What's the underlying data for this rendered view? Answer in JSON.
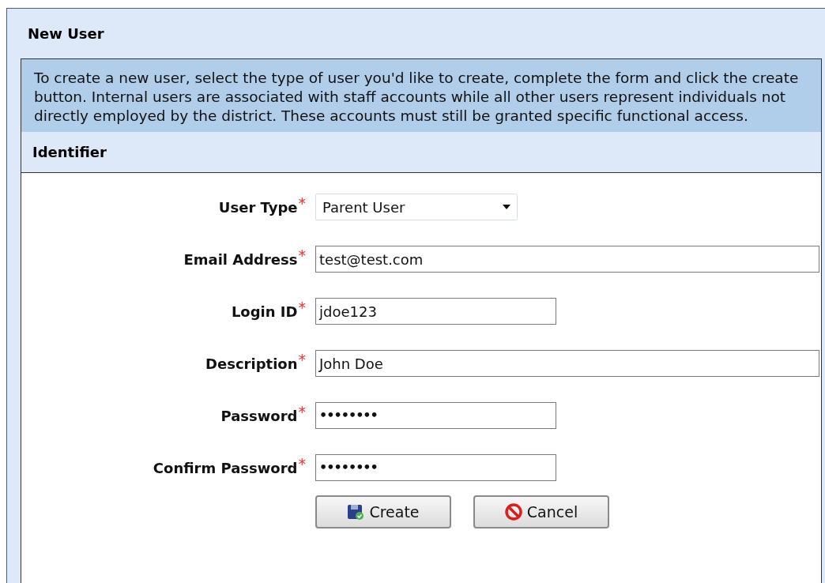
{
  "panel": {
    "title": "New User"
  },
  "instructions": "To create a new user, select the type of user you'd like to create, complete the form and click the create button. Internal users are associated with staff accounts while all other users represent individuals not directly employed by the district. These accounts must still be granted specific functional access.",
  "section": {
    "title": "Identifier"
  },
  "fields": [
    {
      "label": "User Type",
      "required_mark": "*",
      "kind": "select",
      "value": "Parent User"
    },
    {
      "label": "Email Address",
      "required_mark": "*",
      "kind": "text",
      "value": "test@test.com"
    },
    {
      "label": "Login ID",
      "required_mark": "*",
      "kind": "text",
      "value": "jdoe123"
    },
    {
      "label": "Description",
      "required_mark": "*",
      "kind": "text",
      "value": "John Doe"
    },
    {
      "label": "Password",
      "required_mark": "*",
      "kind": "password",
      "value": "••••••••"
    },
    {
      "label": "Confirm Password",
      "required_mark": "*",
      "kind": "password",
      "value": "••••••••"
    }
  ],
  "buttons": [
    {
      "label": "Create",
      "kind": "create"
    },
    {
      "label": "Cancel",
      "kind": "cancel"
    }
  ]
}
